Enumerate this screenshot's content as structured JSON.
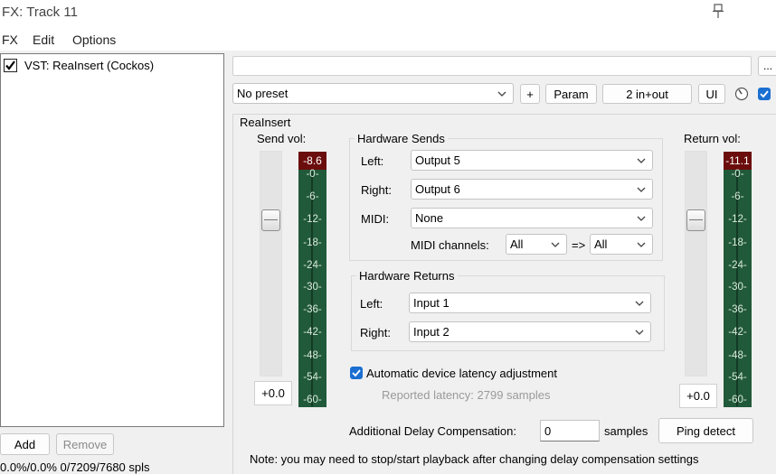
{
  "window": {
    "title": "FX: Track 11"
  },
  "menu": {
    "items": [
      "FX",
      "Edit",
      "Options"
    ]
  },
  "fx_list": {
    "items": [
      {
        "label": "VST: ReaInsert (Cockos)",
        "enabled": true
      }
    ]
  },
  "bottom_left": {
    "add_label": "Add",
    "remove_label": "Remove",
    "status": "0.0%/0.0% 0/7209/7680 spls"
  },
  "toolbar": {
    "more_label": "...",
    "preset_value": "No preset",
    "plus_label": "+",
    "param_label": "Param",
    "io_label": "2 in+out",
    "ui_label": "UI",
    "bypass_checked": true
  },
  "plugin": {
    "name": "ReaInsert",
    "send": {
      "label": "Send vol:",
      "value": "+0.0",
      "peak": "-8.6",
      "ticks": [
        "-0-",
        "-6-",
        "-12-",
        "-18-",
        "-24-",
        "-30-",
        "-36-",
        "-42-",
        "-48-",
        "-54-",
        "-60-"
      ]
    },
    "return": {
      "label": "Return vol:",
      "value": "+0.0",
      "peak": "-11.1",
      "ticks": [
        "-0-",
        "-6-",
        "-12-",
        "-18-",
        "-24-",
        "-30-",
        "-36-",
        "-42-",
        "-48-",
        "-54-",
        "-60-"
      ]
    },
    "hardware_sends": {
      "title": "Hardware Sends",
      "left_label": "Left:",
      "left_value": "Output 5",
      "right_label": "Right:",
      "right_value": "Output 6",
      "midi_label": "MIDI:",
      "midi_value": "None",
      "midi_channels_label": "MIDI channels:",
      "midi_ch_from": "All",
      "arrow": "=>",
      "midi_ch_to": "All"
    },
    "hardware_returns": {
      "title": "Hardware Returns",
      "left_label": "Left:",
      "left_value": "Input 1",
      "right_label": "Right:",
      "right_value": "Input 2"
    },
    "latency": {
      "auto_label": "Automatic device latency adjustment",
      "auto_checked": true,
      "reported": "Reported latency: 2799 samples"
    },
    "delay": {
      "label": "Additional Delay Compensation:",
      "value": "0",
      "unit": "samples",
      "ping_label": "Ping detect"
    },
    "note": "Note: you may need to stop/start playback after changing delay compensation settings"
  },
  "colors": {
    "meter_green": "#215a3a",
    "meter_peak_red": "#6b0d0d",
    "checkbox_blue": "#1a6fd1"
  }
}
